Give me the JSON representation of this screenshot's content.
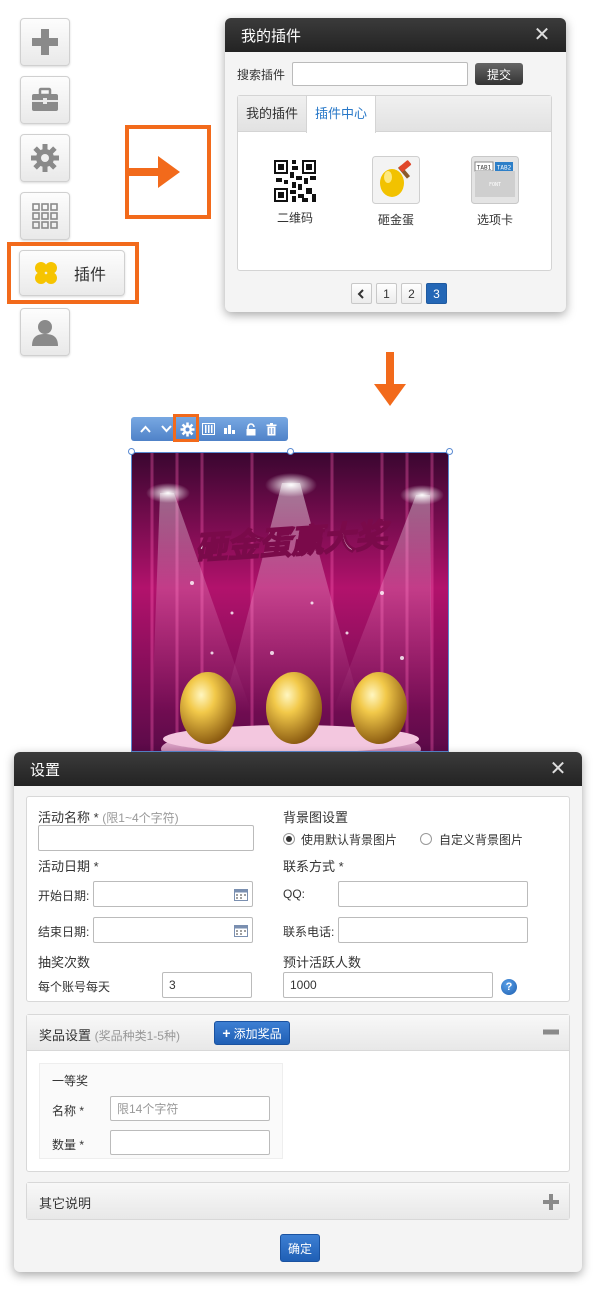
{
  "toolbar": {
    "plugin_label": "插件"
  },
  "plugin_dialog": {
    "title": "我的插件",
    "search_label": "搜索插件",
    "search_value": "",
    "submit_label": "提交",
    "tabs": [
      "我的插件",
      "插件中心"
    ],
    "items": [
      {
        "label": "二维码",
        "icon": "qr-code-icon"
      },
      {
        "label": "砸金蛋",
        "icon": "golden-egg-icon"
      },
      {
        "label": "选项卡",
        "icon": "tabs-icon"
      }
    ],
    "pager": {
      "pages": [
        "1",
        "2",
        "3"
      ],
      "current": "3"
    }
  },
  "poster": {
    "headline": "砸金蛋赢大奖"
  },
  "settings": {
    "title": "设置",
    "activity_name_label": "活动名称 *",
    "activity_name_hint": "(限1~4个字符)",
    "activity_name_value": "",
    "bg_label": "背景图设置",
    "bg_options": [
      "使用默认背景图片",
      "自定义背景图片"
    ],
    "bg_selected": "使用默认背景图片",
    "date_label": "活动日期 *",
    "start_label": "开始日期:",
    "end_label": "结束日期:",
    "contact_label": "联系方式 *",
    "qq_label": "QQ:",
    "phone_label": "联系电话:",
    "draw_label": "抽奖次数",
    "per_account_label": "每个账号每天",
    "per_account_value": "3",
    "active_users_label": "预计活跃人数",
    "active_users_value": "1000",
    "prize_title": "奖品设置",
    "prize_hint": "(奖品种类1-5种)",
    "add_prize_label": "添加奖品",
    "prize_level": "一等奖",
    "prize_name_label": "名称 *",
    "prize_name_placeholder": "限14个字符",
    "prize_qty_label": "数量 *",
    "other_title": "其它说明",
    "confirm_label": "确定"
  },
  "colors": {
    "highlight": "#f26a1b",
    "accent_blue": "#2467b6",
    "dialog_header": "#2b2b2b"
  }
}
